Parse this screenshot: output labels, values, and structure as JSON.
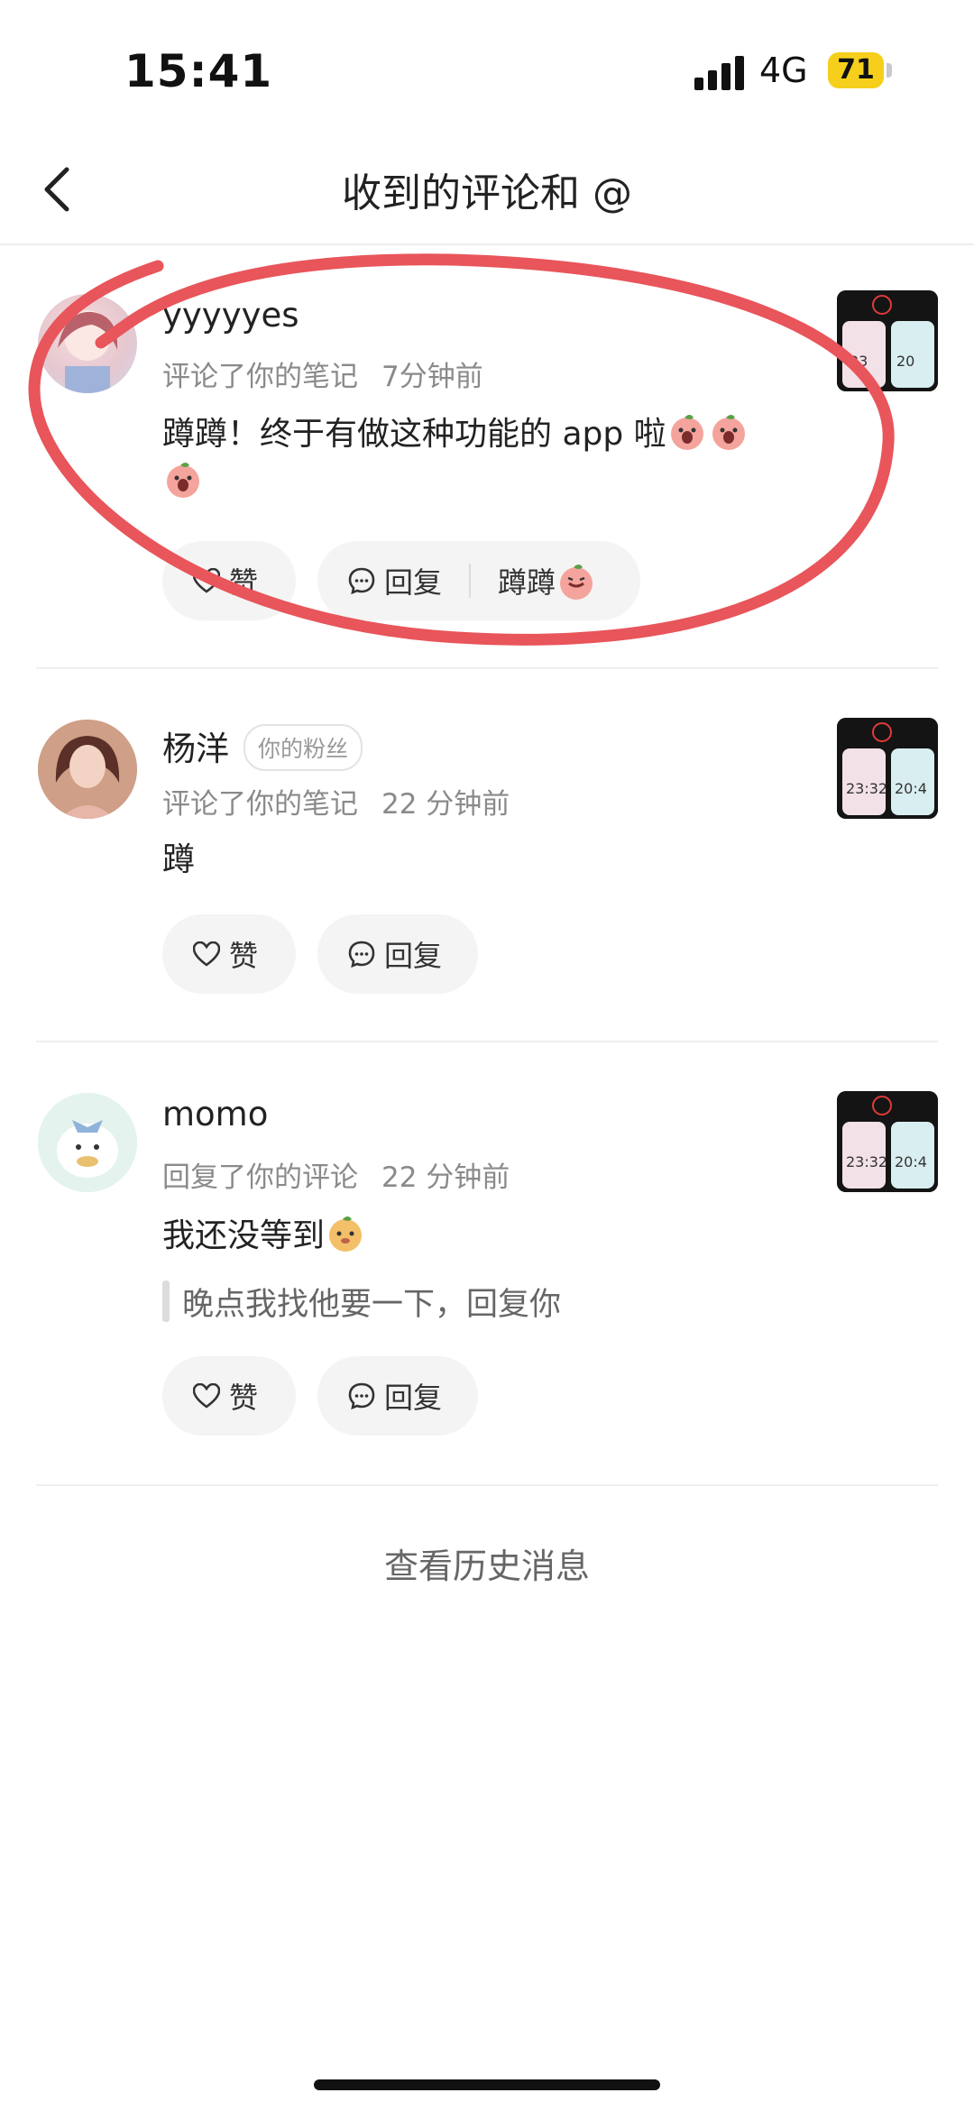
{
  "status_bar": {
    "time": "15:41",
    "network": "4G",
    "battery": "71"
  },
  "header": {
    "title": "收到的评论和 @"
  },
  "items": [
    {
      "username": "yyyyyes",
      "action": "评论了你的笔记",
      "time_ago": "7分钟前",
      "comment": "蹲蹲！终于有做这种功能的 app 啦",
      "like_label": "赞",
      "reply_label": "回复",
      "quick_reply_label": "蹲蹲"
    },
    {
      "username": "杨洋",
      "badge": "你的粉丝",
      "action": "评论了你的笔记",
      "time_ago": "22 分钟前",
      "comment": "蹲",
      "like_label": "赞",
      "reply_label": "回复"
    },
    {
      "username": "momo",
      "action": "回复了你的评论",
      "time_ago": "22 分钟前",
      "comment": "我还没等到",
      "quote": "晚点我找他要一下，回复你",
      "like_label": "赞",
      "reply_label": "回复"
    }
  ],
  "thumbnail_times": [
    "23:32",
    "20:4"
  ],
  "footer": {
    "history_link": "查看历史消息"
  },
  "colors": {
    "annotation_circle": "#e8555a",
    "battery": "#f6cf1c"
  }
}
